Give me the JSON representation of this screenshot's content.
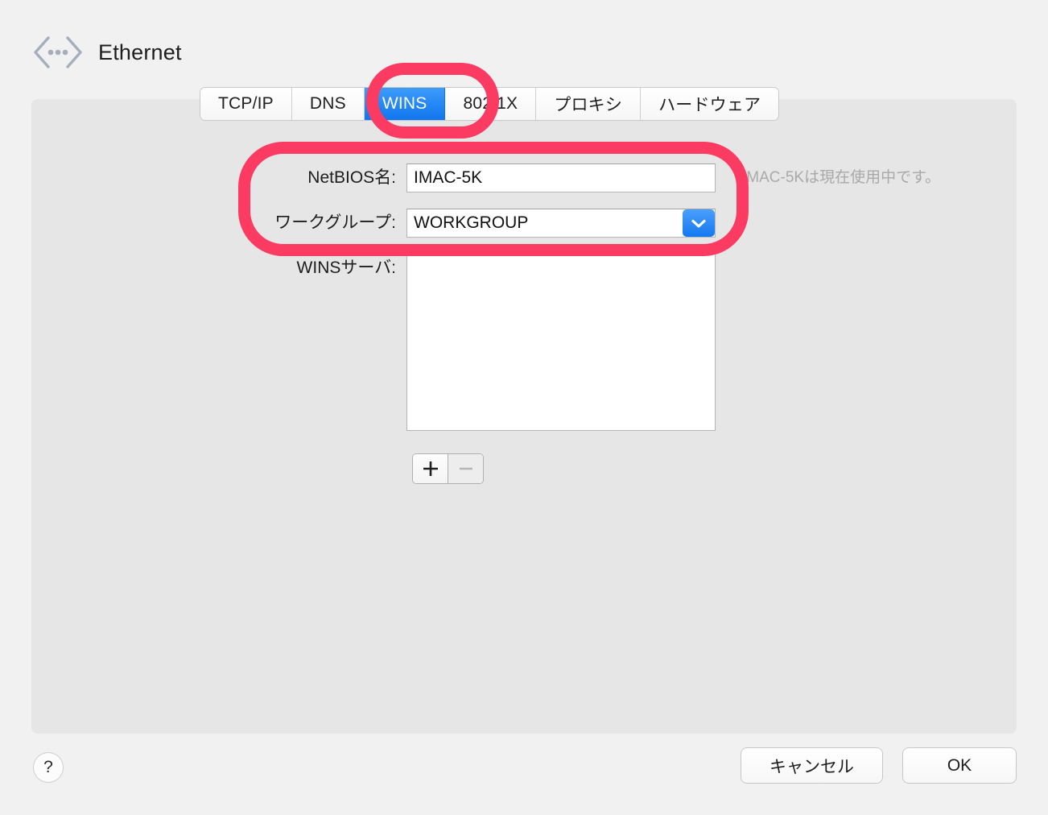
{
  "header": {
    "title": "Ethernet",
    "icon": "ethernet-icon"
  },
  "tabs": [
    {
      "id": "tcpip",
      "label": "TCP/IP",
      "selected": false
    },
    {
      "id": "dns",
      "label": "DNS",
      "selected": false
    },
    {
      "id": "wins",
      "label": "WINS",
      "selected": true
    },
    {
      "id": "8021x",
      "label": "802.1X",
      "selected": false
    },
    {
      "id": "proxy",
      "label": "プロキシ",
      "selected": false
    },
    {
      "id": "hardware",
      "label": "ハードウェア",
      "selected": false
    }
  ],
  "form": {
    "netbios": {
      "label": "NetBIOS名:",
      "value": "IMAC-5K",
      "placeholder": ""
    },
    "workgroup": {
      "label": "ワークグループ:",
      "value": "WORKGROUP",
      "placeholder": ""
    },
    "wins_servers": {
      "label": "WINSサーバ:",
      "items": []
    },
    "info_message": "IMAC-5Kは現在使用中です。"
  },
  "stepper": {
    "add_label": "+",
    "remove_label": "−",
    "add_enabled": true,
    "remove_enabled": false
  },
  "footer": {
    "help_label": "?",
    "cancel_label": "キャンセル",
    "ok_label": "OK"
  },
  "colors": {
    "accent_blue": "#1076ef",
    "annotation_pink": "#fb3b62",
    "panel_bg": "#e6e6e6",
    "window_bg": "#f1f1f1",
    "disabled_text": "#a9a9a9"
  }
}
